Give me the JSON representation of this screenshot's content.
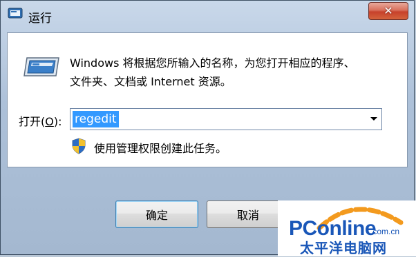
{
  "window": {
    "title": "运行",
    "close_glyph": "✕"
  },
  "dialog": {
    "description_line1": "Windows 将根据您所输入的名称，为您打开相应的程序、",
    "description_line2": "文件夹、文档或 Internet 资源。",
    "open_label_prefix": "打开(",
    "open_label_hotkey": "O",
    "open_label_suffix": "):",
    "open_value": "regedit",
    "admin_note": "使用管理权限创建此任务。"
  },
  "buttons": {
    "ok_label": "确定",
    "cancel_label": "取消"
  },
  "watermark": {
    "brand": "PConline",
    "suffix": ".com.cn",
    "subtitle": "太平洋电脑网"
  },
  "colors": {
    "selection": "#3399ff",
    "close_red": "#c7412b",
    "brand_blue": "#1a57b8",
    "brand_orange": "#f39a1e"
  },
  "icons": [
    "run-app-icon",
    "run-program-icon",
    "uac-shield-icon",
    "dropdown-arrow-icon",
    "close-icon"
  ]
}
